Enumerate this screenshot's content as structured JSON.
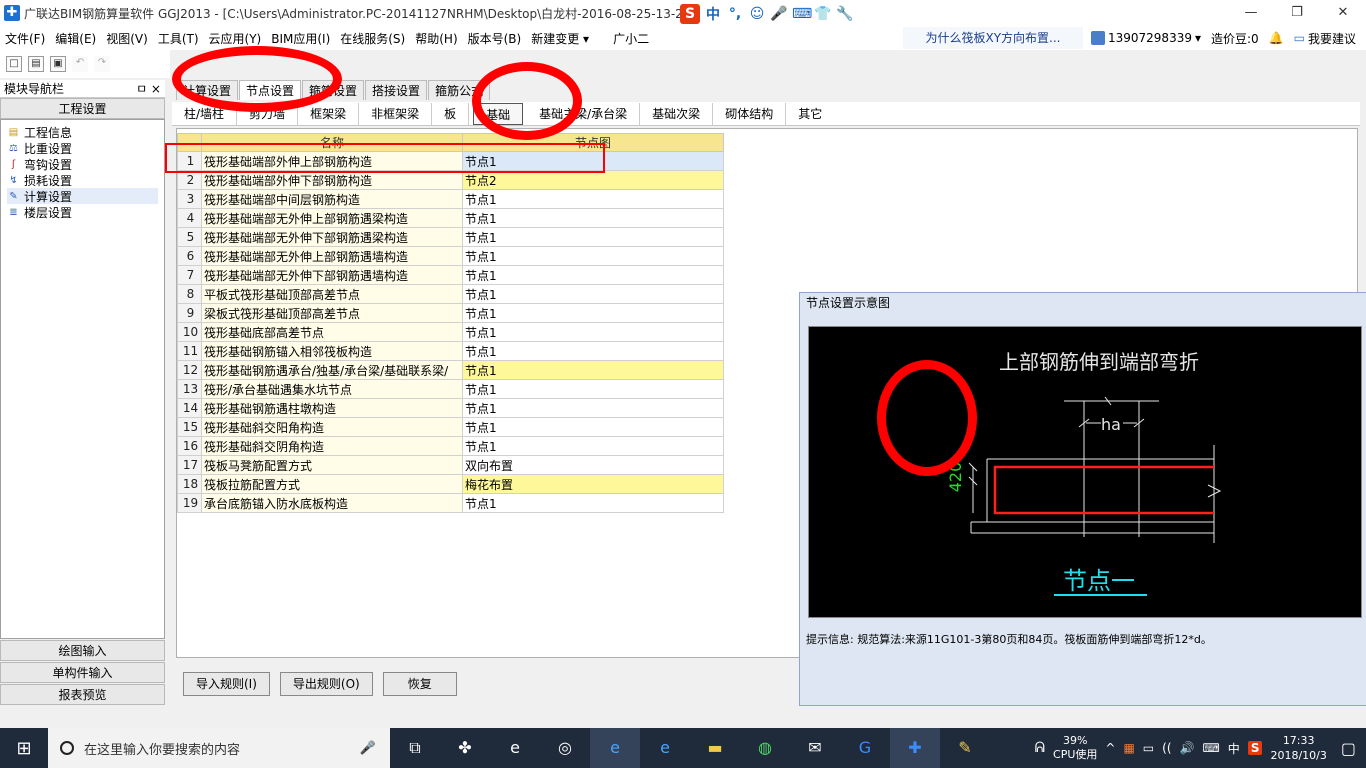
{
  "window": {
    "title": "广联达BIM钢筋算量软件 GGJ2013 - [C:\\Users\\Administrator.PC-20141127NRHM\\Desktop\\白龙村-2016-08-25-13-27",
    "controls": [
      "—",
      "❐",
      "✕"
    ]
  },
  "ime": {
    "logo": "S",
    "items": [
      "中",
      "°,",
      "☺",
      "🎤",
      "⌨",
      "👕",
      "🔧"
    ]
  },
  "menu": {
    "items": [
      "文件(F)",
      "编辑(E)",
      "视图(V)",
      "工具(T)",
      "云应用(Y)",
      "BIM应用(I)",
      "在线服务(S)",
      "帮助(H)",
      "版本号(B)",
      "新建变更 ▾",
      "广小二"
    ],
    "notice": "为什么筏板XY方向布置...",
    "phone": "13907298339",
    "coins": "造价豆:0",
    "suggest": "我要建议"
  },
  "toolbar": {
    "icons": [
      "□",
      "▤",
      "▣",
      "↶",
      "↷"
    ]
  },
  "nav": {
    "header": "模块导航栏",
    "pin": "ㅁ ×",
    "top_tab": "工程设置",
    "items": [
      "工程信息",
      "比重设置",
      "弯钩设置",
      "损耗设置",
      "计算设置",
      "楼层设置"
    ],
    "bottom_tabs": [
      "绘图输入",
      "单构件输入",
      "报表预览"
    ]
  },
  "tabs_primary": [
    "计算设置",
    "节点设置",
    "箍筋设置",
    "搭接设置",
    "箍筋公式"
  ],
  "tabs_primary_active": 1,
  "tabs_secondary": [
    "柱/墙柱",
    "剪力墙",
    "框架梁",
    "非框架梁",
    "板",
    "基础",
    "基础主梁/承台梁",
    "基础次梁",
    "砌体结构",
    "其它"
  ],
  "tabs_secondary_active": 5,
  "table": {
    "headers": [
      "",
      "名称",
      "节点图"
    ],
    "rows": [
      {
        "num": "1",
        "name": "筏形基础端部外伸上部钢筋构造",
        "value": "节点1",
        "style": "sel"
      },
      {
        "num": "2",
        "name": "筏形基础端部外伸下部钢筋构造",
        "value": "节点2",
        "style": "hl"
      },
      {
        "num": "3",
        "name": "筏形基础端部中间层钢筋构造",
        "value": "节点1",
        "style": ""
      },
      {
        "num": "4",
        "name": "筏形基础端部无外伸上部钢筋遇梁构造",
        "value": "节点1",
        "style": ""
      },
      {
        "num": "5",
        "name": "筏形基础端部无外伸下部钢筋遇梁构造",
        "value": "节点1",
        "style": ""
      },
      {
        "num": "6",
        "name": "筏形基础端部无外伸上部钢筋遇墙构造",
        "value": "节点1",
        "style": ""
      },
      {
        "num": "7",
        "name": "筏形基础端部无外伸下部钢筋遇墙构造",
        "value": "节点1",
        "style": ""
      },
      {
        "num": "8",
        "name": "平板式筏形基础顶部高差节点",
        "value": "节点1",
        "style": ""
      },
      {
        "num": "9",
        "name": "梁板式筏形基础顶部高差节点",
        "value": "节点1",
        "style": ""
      },
      {
        "num": "10",
        "name": "筏形基础底部高差节点",
        "value": "节点1",
        "style": ""
      },
      {
        "num": "11",
        "name": "筏形基础钢筋锚入相邻筏板构造",
        "value": "节点1",
        "style": ""
      },
      {
        "num": "12",
        "name": "筏形基础钢筋遇承台/独基/承台梁/基础联系梁/",
        "value": "节点1",
        "style": "hl"
      },
      {
        "num": "13",
        "name": "筏形/承台基础遇集水坑节点",
        "value": "节点1",
        "style": ""
      },
      {
        "num": "14",
        "name": "筏形基础钢筋遇柱墩构造",
        "value": "节点1",
        "style": ""
      },
      {
        "num": "15",
        "name": "筏形基础斜交阳角构造",
        "value": "节点1",
        "style": ""
      },
      {
        "num": "16",
        "name": "筏形基础斜交阴角构造",
        "value": "节点1",
        "style": ""
      },
      {
        "num": "17",
        "name": "筏板马凳筋配置方式",
        "value": "双向布置",
        "style": ""
      },
      {
        "num": "18",
        "name": "筏板拉筋配置方式",
        "value": "梅花布置",
        "style": "hl"
      },
      {
        "num": "19",
        "name": "承台底筋锚入防水底板构造",
        "value": "节点1",
        "style": ""
      }
    ]
  },
  "diagram": {
    "title": "节点设置示意图",
    "heading": "上部钢筋伸到端部弯折",
    "dim_ha": "ha",
    "dim_420": "420",
    "node_label": "节点一",
    "hint": "提示信息:  规范算法:来源11G101-3第80页和84页。筏板面筋伸到端部弯折12*d。",
    "colors": {
      "text": "#e6e6e6",
      "rebar": "#ff2020",
      "green": "#22dd22",
      "cyan": "#22ddee"
    }
  },
  "buttons": [
    "导入规则(I)",
    "导出规则(O)",
    "恢复"
  ],
  "taskbar": {
    "start": "⊞",
    "search_placeholder": "在这里输入你要搜索的内容",
    "mic": "🎤",
    "apps": [
      "⧉",
      "✤",
      "e",
      "◎",
      "e",
      "e",
      "▬",
      "◍",
      "✉",
      "G",
      "✚",
      "✎"
    ],
    "cpu_pct": "39%",
    "cpu_label": "CPU使用",
    "tray": [
      "^",
      "▦",
      "▭",
      "((",
      "🔊",
      "⌨",
      "中",
      "S"
    ],
    "time": "17:33",
    "date": "2018/10/3",
    "notify": "▢"
  }
}
